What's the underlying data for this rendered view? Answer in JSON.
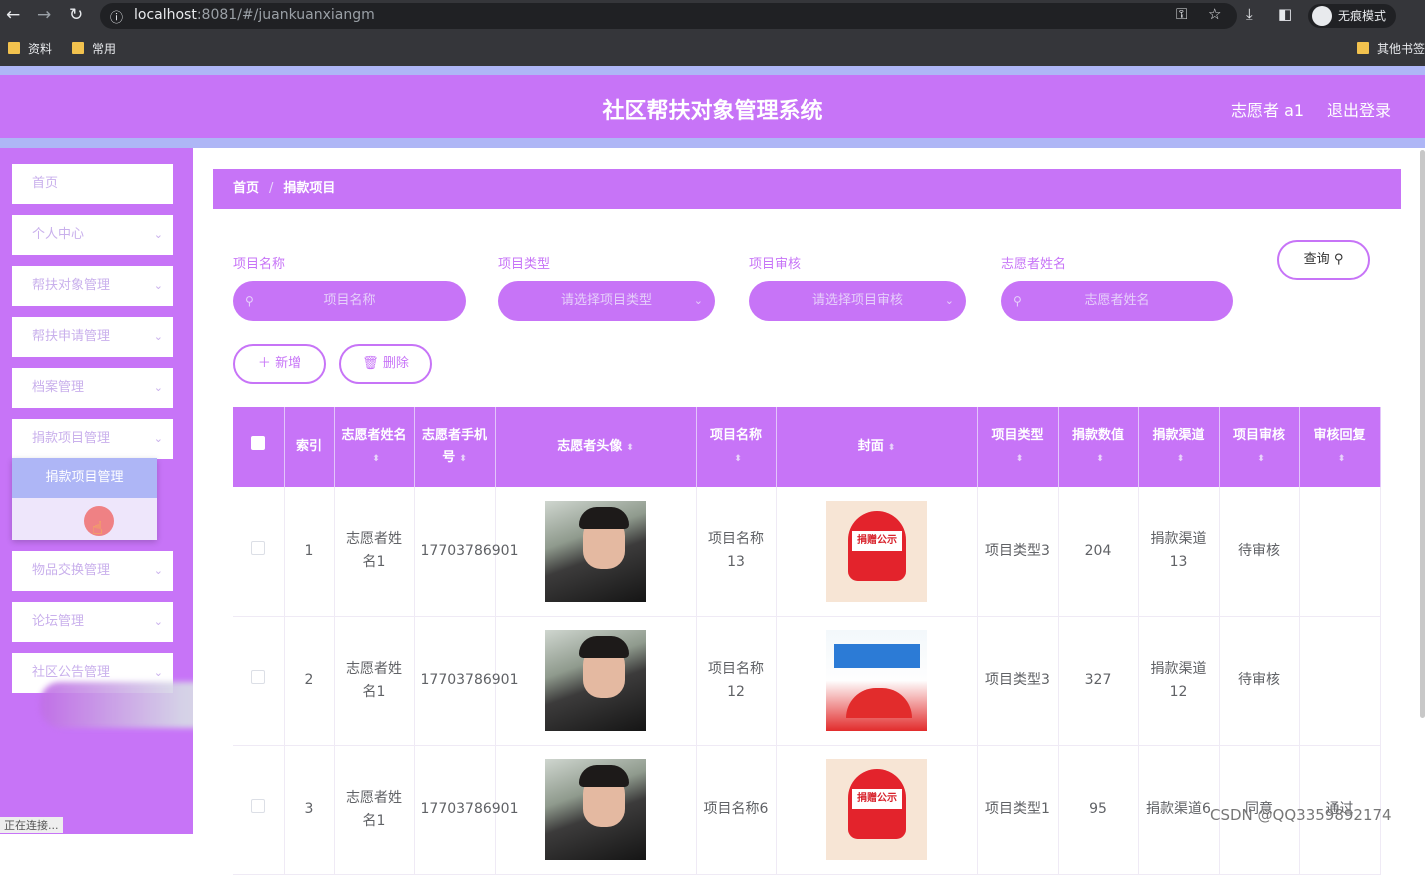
{
  "browser": {
    "url_host": "localhost",
    "url_rest": ":8081/#/juankuanxiangm",
    "incognito_label": "无痕模式",
    "bookmarks": [
      "资料",
      "常用"
    ],
    "other_bookmarks": "其他书签"
  },
  "header": {
    "title": "社区帮扶对象管理系统",
    "user": "志愿者 a1",
    "logout": "退出登录"
  },
  "sidebar": {
    "items": [
      {
        "label": "首页"
      },
      {
        "label": "个人中心"
      },
      {
        "label": "帮扶对象管理"
      },
      {
        "label": "帮扶申请管理"
      },
      {
        "label": "档案管理"
      },
      {
        "label": "捐款项目管理"
      },
      {
        "label": "物品交换管理"
      },
      {
        "label": "论坛管理"
      },
      {
        "label": "社区公告管理"
      }
    ],
    "submenu_active": "捐款项目管理"
  },
  "breadcrumb": {
    "home": "首页",
    "sep": "/",
    "current": "捐款项目"
  },
  "filters": {
    "name_label": "项目名称",
    "name_placeholder": "项目名称",
    "type_label": "项目类型",
    "type_placeholder": "请选择项目类型",
    "review_label": "项目审核",
    "review_placeholder": "请选择项目审核",
    "volunteer_label": "志愿者姓名",
    "volunteer_placeholder": "志愿者姓名",
    "query": "查询"
  },
  "actions": {
    "add": "新增",
    "delete": "删除"
  },
  "table": {
    "headers": [
      "索引",
      "志愿者姓名",
      "志愿者手机号",
      "志愿者头像",
      "项目名称",
      "封面",
      "项目类型",
      "捐款数值",
      "捐款渠道",
      "项目审核",
      "审核回复"
    ],
    "rows": [
      {
        "index": "1",
        "name": "志愿者姓名1",
        "phone": "17703786901",
        "project": "项目名称13",
        "cover": "heart",
        "cover_text": "捐赠公示",
        "type": "项目类型3",
        "amount": "204",
        "channel": "捐款渠道13",
        "review": "待审核",
        "reply": ""
      },
      {
        "index": "2",
        "name": "志愿者姓名1",
        "phone": "17703786901",
        "project": "项目名称12",
        "cover": "banner",
        "cover_text": "",
        "type": "项目类型3",
        "amount": "327",
        "channel": "捐款渠道12",
        "review": "待审核",
        "reply": ""
      },
      {
        "index": "3",
        "name": "志愿者姓名1",
        "phone": "17703786901",
        "project": "项目名称6",
        "cover": "heart",
        "cover_text": "捐赠公示",
        "type": "项目类型1",
        "amount": "95",
        "channel": "捐款渠道6",
        "review": "同意",
        "reply": "通过"
      }
    ]
  },
  "status_bar": "正在连接...",
  "watermark": "CSDN @QQ3359892174",
  "colors": {
    "accent": "#c774f7",
    "accent_light": "#aeb6f6"
  }
}
